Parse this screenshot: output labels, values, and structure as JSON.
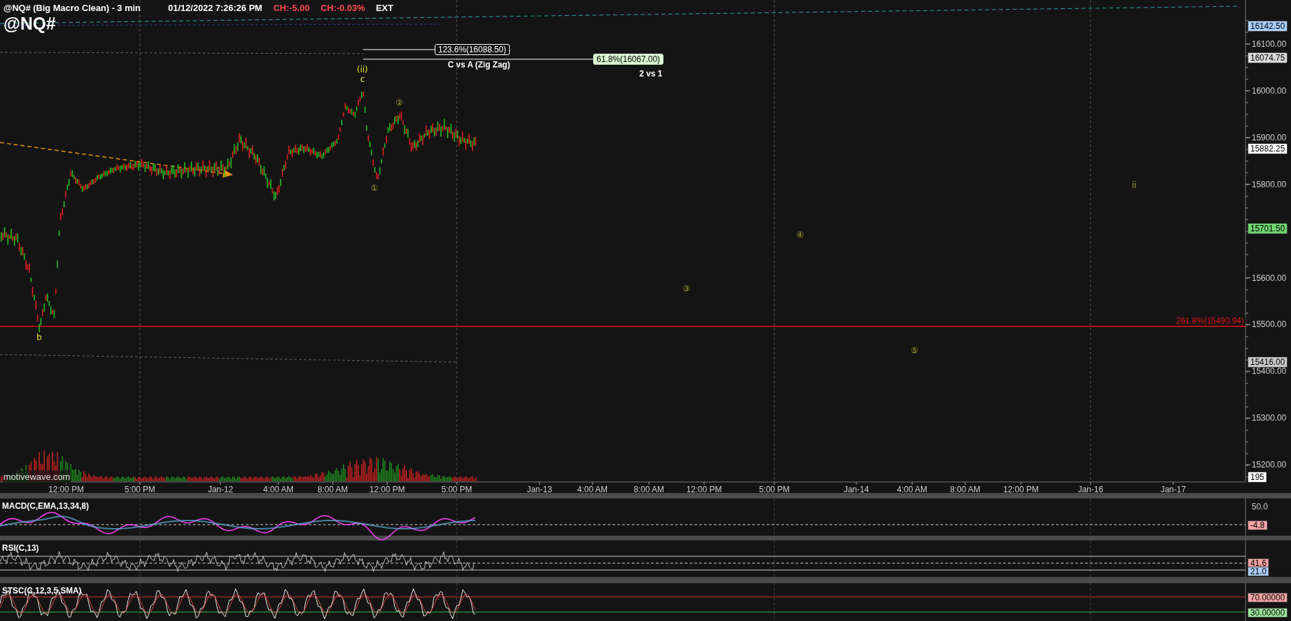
{
  "header": {
    "chart_title": "@NQ# (Big Macro Clean) - 3 min",
    "datetime": "01/12/2022 7:26:26 PM",
    "change": "CH:-5.00",
    "change_percent": "CH:-0.03%",
    "session": "EXT",
    "symbol": "@NQ#"
  },
  "fib_labels": [
    {
      "kind": "outlined",
      "text": "123.6%(16088.50)",
      "caption": "C vs A (Zig Zag)"
    },
    {
      "kind": "filled",
      "text": "61.8%(16067.00)",
      "caption": "2 vs 1"
    }
  ],
  "wave_labels": [
    "(ii)",
    "c",
    "b",
    "①",
    "②",
    "③",
    "④",
    "⑤",
    "ii"
  ],
  "red_line_label": "261.8%(15490.94)",
  "price_axis": {
    "ticks": [
      "16100.00",
      "16000.00",
      "15900.00",
      "15800.00",
      "15600.00",
      "15500.00",
      "15400.00",
      "15300.00",
      "15200.00"
    ],
    "markers": [
      {
        "text": "16142.50",
        "color": "#a9cdf7"
      },
      {
        "text": "16074.75",
        "color": "#d9d9d9"
      },
      {
        "text": "15882.25",
        "color": "#ffffff"
      },
      {
        "text": "15701.50",
        "color": "#6fd36f"
      },
      {
        "text": "15416.00",
        "color": "#c8c8c8"
      },
      {
        "text": "195",
        "color": "#ffffff"
      }
    ]
  },
  "watermark_text": "motivewave.com",
  "time_axis": [
    "12:00 PM",
    "5:00 PM",
    "Jan-12",
    "4:00 AM",
    "8:00 AM",
    "12:00 PM",
    "5:00 PM",
    "Jan-13",
    "4:00 AM",
    "8:00 AM",
    "12:00 PM",
    "5:00 PM",
    "Jan-14",
    "4:00 AM",
    "8:00 AM",
    "12:00 PM",
    "Jan-16",
    "Jan-17"
  ],
  "indicators": [
    {
      "kind": "macd",
      "title": "MACD(C,EMA,13,34,8)",
      "ticks": [
        "50.0"
      ],
      "markers": [
        {
          "text": "-4.8",
          "color": "#f4a3a3"
        }
      ]
    },
    {
      "kind": "rsi",
      "title": "RSI(C,13)",
      "markers": [
        {
          "text": "41.6",
          "color": "#f4a3a3"
        },
        {
          "text": "21.0",
          "color": "#a9cdf7"
        }
      ]
    },
    {
      "kind": "stochastic",
      "title": "STSC(C,12,3,5,SMA)",
      "markers": [
        {
          "text": "70.00000",
          "color": "#f4a3a3"
        },
        {
          "text": "30.00000",
          "color": "#9be59b"
        }
      ]
    }
  ]
}
